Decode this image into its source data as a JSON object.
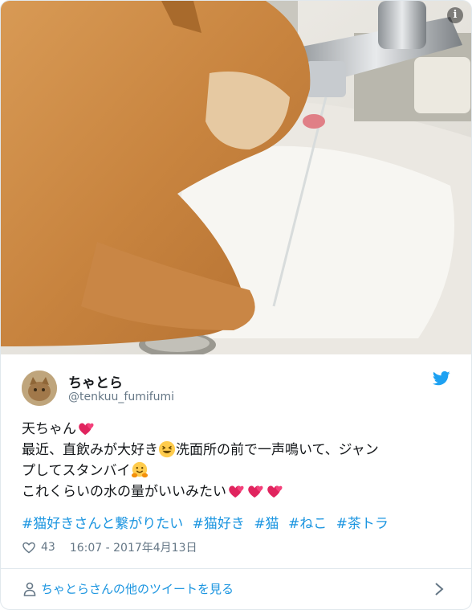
{
  "tweet": {
    "display_name": "ちゃとら",
    "handle": "@tenkuu_fumifumi",
    "text_line1": "天ちゃん",
    "text_line2": "最近、直飲みが大好き",
    "text_line2b": "洗面所の前で一声鳴いて、ジャン",
    "text_line3": "プしてスタンバイ",
    "text_line4": "これくらいの水の量がいいみたい",
    "hashtags": [
      "#猫好きさんと繋がりたい",
      "#猫好き",
      "#猫",
      "#ねこ",
      "#茶トラ"
    ],
    "likes": "43",
    "timestamp": "16:07 - 2017年4月13日",
    "footer_link": "ちゃとらさんの他のツイートを見る"
  },
  "icons": {
    "media_info": "info-icon",
    "brand": "twitter-bird-icon",
    "like": "heart-outline-icon",
    "footer_person": "person-icon",
    "footer_arrow": "chevron-right-icon",
    "emoji": [
      "two-hearts-emoji",
      "grinning-squint-emoji",
      "hugging-face-emoji"
    ]
  },
  "colors": {
    "link": "#1b95e0",
    "text": "#14171a",
    "secondary": "#657786",
    "border": "#e1e8ed",
    "twitter_blue": "#1da1f2",
    "heart_pink": "#e0245e"
  }
}
